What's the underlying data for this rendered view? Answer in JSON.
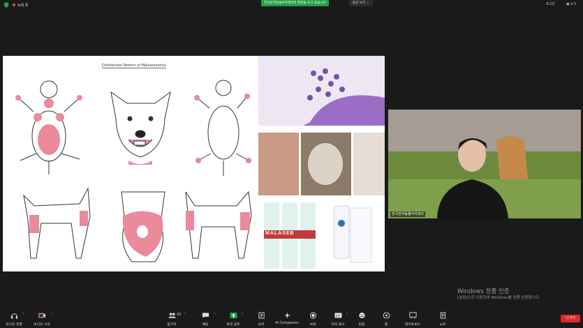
{
  "topbar": {
    "recording_label": "녹화 중",
    "share_banner": "한국반려동물아카데미의 화면을 보고 있습니다",
    "view_options": "옵션 보기",
    "login": "로그인",
    "view": "보기"
  },
  "slide": {
    "title": "Distribution Pattern of Malassezioisis",
    "bottle_label": "MALASEB"
  },
  "webcam": {
    "name": "한국반려동물아카데미"
  },
  "watermark": {
    "line1": "Windows 정품 인증",
    "line2": "[설정]으로 이동하여 Windows를 정품 인증합니다."
  },
  "toolbar": {
    "audio": "오디오 연결",
    "video": "비디오 시작",
    "participants": "참가자",
    "participants_count": "43",
    "chat": "채팅",
    "share": "화면 공유",
    "summary": "요약",
    "ai": "AI Companion",
    "record": "녹화",
    "captions": "자막 표시",
    "reactions": "반응",
    "apps": "앱",
    "whiteboard": "화이트보드",
    "notes": "노트",
    "leave": "나가기"
  },
  "colors": {
    "accent_green": "#23a047",
    "leave_red": "#e02828",
    "lesion_pink": "#ea8a9a"
  }
}
